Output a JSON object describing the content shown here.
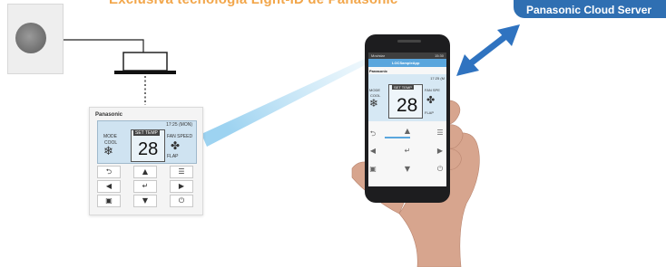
{
  "headline": "Exclusiva tecnología Light-ID de Panasonic",
  "cloud_server_label": "Panasonic Cloud Server",
  "remote": {
    "brand": "Panasonic",
    "time": "17:25 (MON)",
    "mode_label": "MODE",
    "mode_value": "COOL",
    "set_temp_label": "SET TEMP",
    "temperature": "28",
    "fan_speed_label": "FAN SPEED",
    "flap_label": "FLAP",
    "keys": [
      "⮌",
      "▲",
      "☰",
      "◀",
      "↵",
      "▶",
      "▣",
      "▼",
      "⏻"
    ]
  },
  "phone": {
    "status_left": "Movistar",
    "status_right": "15:30",
    "app_title": "LOCSampleApp",
    "brand": "Panasonic",
    "time": "17:25 (M",
    "mode_label": "MODE",
    "mode_value": "COOL",
    "set_temp_label": "SET TEMP",
    "temperature": "28",
    "fan_speed_label": "FAN SPE",
    "flap_label": "FLAP",
    "keys": [
      "⮌",
      "▲",
      "☰",
      "◀",
      "↵",
      "▶",
      "▣",
      "▼",
      "⏻"
    ]
  },
  "colors": {
    "headline": "#f2a64a",
    "cloud_badge": "#2f6fb2",
    "arrow": "#2f73c0",
    "light_beam": "#9fd4f0",
    "app_bar": "#5aa6dd"
  }
}
